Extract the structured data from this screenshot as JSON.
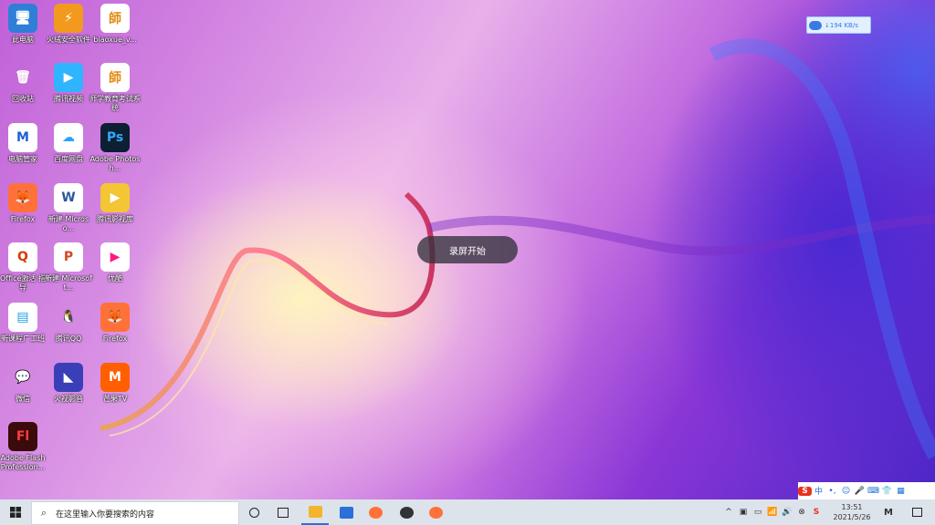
{
  "desktop_icons": [
    {
      "label": "此电脑",
      "glyph": "🖥",
      "bg": "#2f7fd8",
      "col": 0,
      "row": 0,
      "shortcut": false
    },
    {
      "label": "火绒安全软件",
      "glyph": "⚡",
      "bg": "#f39a1e",
      "col": 1,
      "row": 0,
      "shortcut": true
    },
    {
      "label": "biaoxue_v...",
      "glyph": "師",
      "bg": "#ffffff",
      "fg": "#e08a10",
      "col": 2,
      "row": 0,
      "shortcut": true
    },
    {
      "label": "回收站",
      "glyph": "🗑",
      "bg": "transparent",
      "col": 0,
      "row": 1,
      "shortcut": false
    },
    {
      "label": "腾讯视频",
      "glyph": "▶",
      "bg": "#2fb4ff",
      "col": 1,
      "row": 1,
      "shortcut": true
    },
    {
      "label": "师学教育考试系统",
      "glyph": "師",
      "bg": "#ffffff",
      "fg": "#e08a10",
      "col": 2,
      "row": 1,
      "shortcut": true
    },
    {
      "label": "电脑管家",
      "glyph": "M",
      "bg": "#ffffff",
      "fg": "#1d5fd6",
      "col": 0,
      "row": 2,
      "shortcut": true
    },
    {
      "label": "百度网盘",
      "glyph": "☁",
      "bg": "#ffffff",
      "fg": "#2aa1ff",
      "col": 1,
      "row": 2,
      "shortcut": true
    },
    {
      "label": "Adobe Photosh...",
      "glyph": "Ps",
      "bg": "#0d1f33",
      "fg": "#31a8ff",
      "col": 2,
      "row": 2,
      "shortcut": true
    },
    {
      "label": "Firefox",
      "glyph": "🦊",
      "bg": "#ff7139",
      "col": 0,
      "row": 3,
      "shortcut": true
    },
    {
      "label": "新建 Microso...",
      "glyph": "W",
      "bg": "#ffffff",
      "fg": "#2b579a",
      "col": 1,
      "row": 3,
      "shortcut": false
    },
    {
      "label": "腾讯影视库",
      "glyph": "▶",
      "bg": "#f4c534",
      "col": 2,
      "row": 3,
      "shortcut": true
    },
    {
      "label": "Office激活 指导",
      "glyph": "Q",
      "bg": "#ffffff",
      "fg": "#d83b01",
      "col": 0,
      "row": 4,
      "shortcut": true
    },
    {
      "label": "新建 Microsoft...",
      "glyph": "P",
      "bg": "#ffffff",
      "fg": "#d24726",
      "col": 1,
      "row": 4,
      "shortcut": false
    },
    {
      "label": "优酷",
      "glyph": "▶",
      "bg": "#ffffff",
      "fg": "#ff1a7a",
      "col": 2,
      "row": 4,
      "shortcut": true
    },
    {
      "label": "新课程广工班",
      "glyph": "▤",
      "bg": "#ffffff",
      "fg": "#1aa0e8",
      "col": 0,
      "row": 5,
      "shortcut": true
    },
    {
      "label": "腾讯QQ",
      "glyph": "🐧",
      "bg": "transparent",
      "col": 1,
      "row": 5,
      "shortcut": true
    },
    {
      "label": "Firefox",
      "glyph": "🦊",
      "bg": "#ff7139",
      "col": 2,
      "row": 5,
      "shortcut": true
    },
    {
      "label": "微信",
      "glyph": "💬",
      "bg": "transparent",
      "fg": "#2dc100",
      "col": 0,
      "row": 6,
      "shortcut": true
    },
    {
      "label": "火视影音",
      "glyph": "◣",
      "bg": "#3a3fb8",
      "col": 1,
      "row": 6,
      "shortcut": true
    },
    {
      "label": "芒果TV",
      "glyph": "M",
      "bg": "#ff5f00",
      "col": 2,
      "row": 6,
      "shortcut": true
    },
    {
      "label": "Adobe Flash Profession...",
      "glyph": "Fl",
      "bg": "#3b0a0a",
      "fg": "#ff3c3c",
      "col": 0,
      "row": 7,
      "shortcut": true
    }
  ],
  "net_speed": "↓194 KB/s",
  "toast": "录屏开始",
  "ime_items": [
    "S",
    "中",
    "•,",
    "☺",
    "🎤",
    "⌨",
    "👕",
    "▦"
  ],
  "taskbar": {
    "search_placeholder": "在这里输入你要搜索的内容",
    "pinned": [
      "file-explorer",
      "mail",
      "firefox",
      "media",
      "firefox-2"
    ]
  },
  "tray": {
    "icons": [
      "^",
      "▣",
      "▭",
      "📶",
      "🔊",
      "⊗",
      "S"
    ],
    "time": "13:51",
    "date": "2021/5/26",
    "ime_label": "M"
  },
  "colors": {
    "taskbar": "#dde3eb",
    "accent": "#2b6fd8"
  }
}
